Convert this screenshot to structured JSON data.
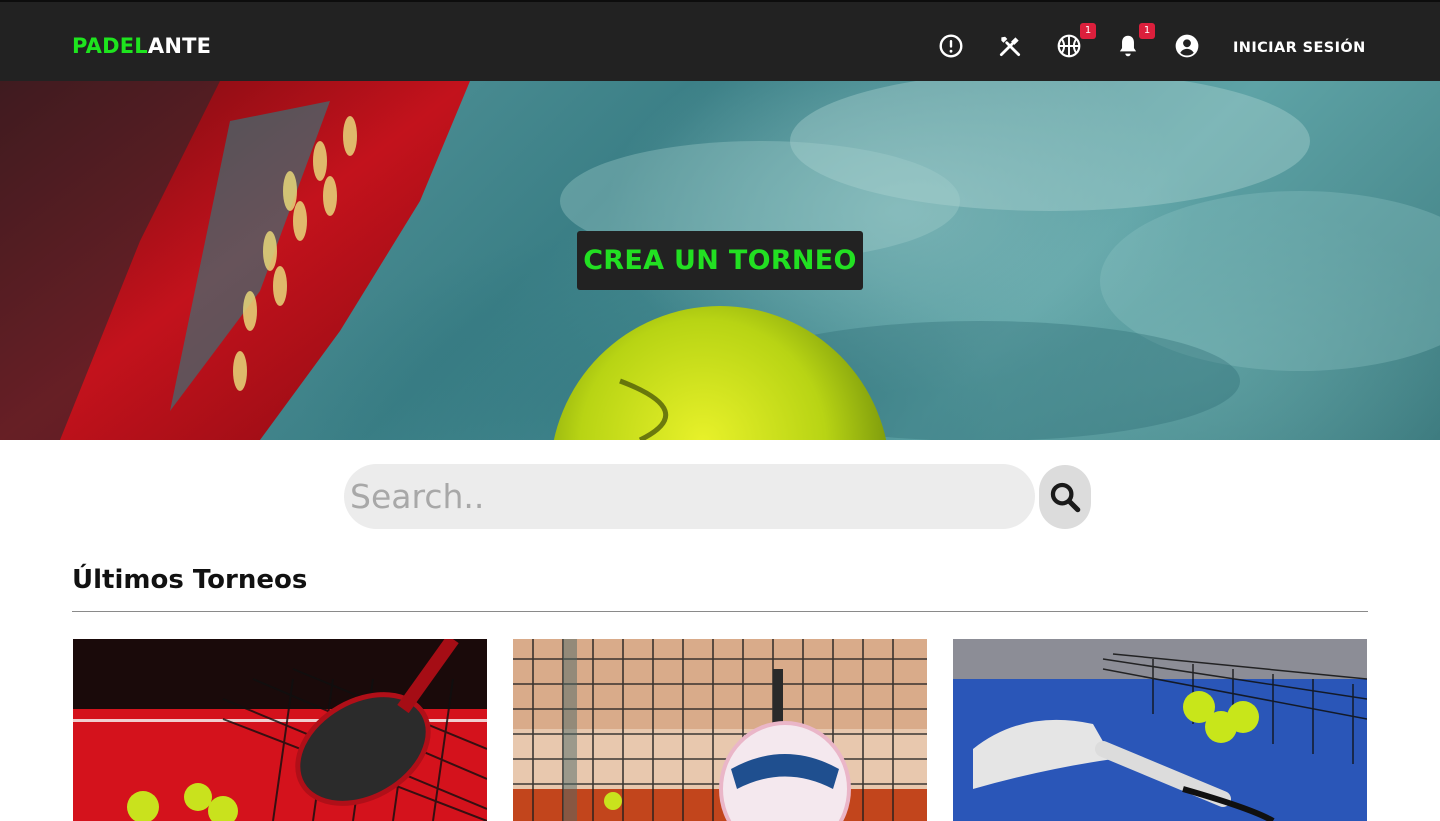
{
  "navbar": {
    "brand_part1": "PADEL",
    "brand_part2": "ANTE",
    "icons": [
      "alert-circle-icon",
      "tools-icon",
      "basketball-icon",
      "bell-icon",
      "account-circle-icon"
    ],
    "badges": {
      "basketball": "1",
      "bell": "1"
    },
    "login_label": "INICIAR SESIÓN"
  },
  "hero": {
    "cta_label": "CREA UN TORNEO"
  },
  "search": {
    "placeholder": "Search..",
    "value": ""
  },
  "section": {
    "title": "Últimos Torneos"
  },
  "colors": {
    "navbar_bg": "#222222",
    "brand_green": "#1ee41e",
    "badge_red": "#dc1f3c",
    "search_bg": "#ececec"
  }
}
